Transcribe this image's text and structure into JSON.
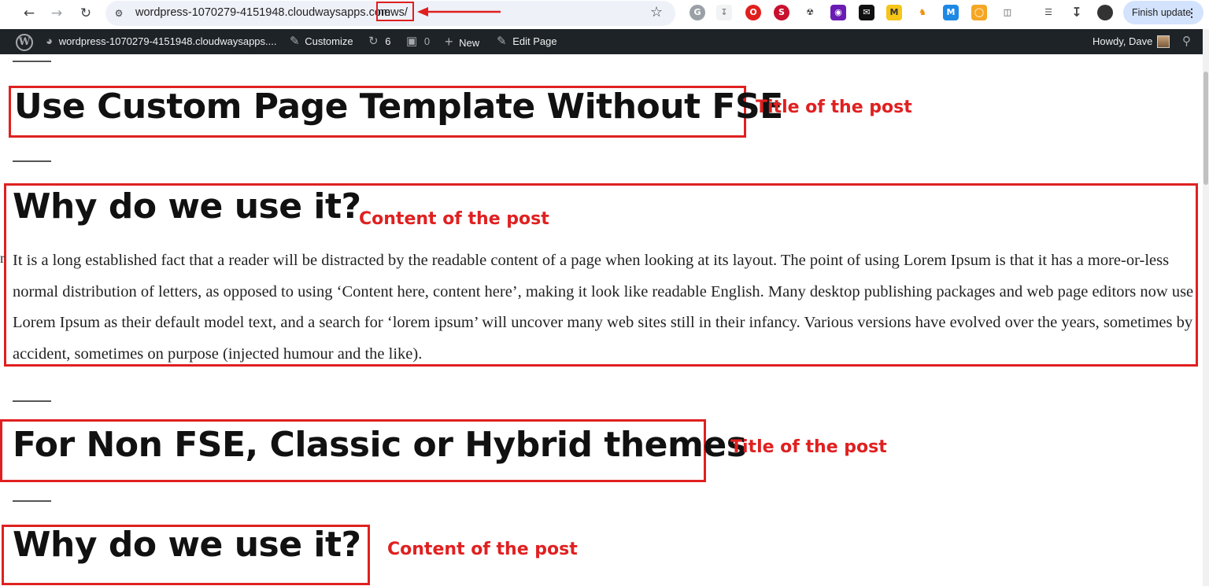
{
  "browser": {
    "url_host": "wordpress-1070279-4151948.cloudwaysapps.com",
    "url_path": "news/",
    "finish_update_label": "Finish update",
    "nav_icons": [
      "back-arrow-icon",
      "forward-arrow-icon",
      "reload-icon"
    ],
    "extension_icons": [
      "grammarly-icon",
      "download-helper-icon",
      "opera-icon",
      "semrush-icon",
      "radiation-icon",
      "purple-extension-icon",
      "mailbox-icon",
      "m-extension-icon",
      "chess-icon",
      "maily-icon",
      "orange-extension-icon",
      "puzzle-icon",
      "media-queue-icon",
      "downloads-icon",
      "profile-avatar-icon"
    ]
  },
  "wp_admin_bar": {
    "site_name": "wordpress-1070279-4151948.cloudwaysapps....",
    "customize": "Customize",
    "updates_count": "6",
    "comments_count": "0",
    "new_label": "New",
    "edit_page": "Edit Page",
    "howdy": "Howdy, Dave"
  },
  "posts": [
    {
      "title": "Use Custom Page Template Without FSE",
      "title_annotation": "Title of the post",
      "content_heading": "Why do we use it?",
      "content_annotation": "Content of the post",
      "paragraph": "It is a long established fact that a reader will be distracted by the readable content of a page when looking at its layout. The point of using Lorem Ipsum is that it has a more-or-less normal distribution of letters, as opposed to using ‘Content here, content here’, making it look like readable English. Many desktop publishing packages and web page editors now use Lorem Ipsum as their default model text, and a search for ‘lorem ipsum’ will uncover many web sites still in their infancy. Various versions have evolved over the years, sometimes by accident, sometimes on purpose (injected humour and the like)."
    },
    {
      "title": "For Non FSE, Classic or Hybrid themes",
      "title_annotation": "Title of the post",
      "content_heading": "Why do we use it?",
      "content_annotation": "Content of the post"
    }
  ],
  "colors": {
    "annotation_red": "#e02020",
    "admin_bar_bg": "#1d2327",
    "finish_update_bg": "#d3e3fd"
  }
}
